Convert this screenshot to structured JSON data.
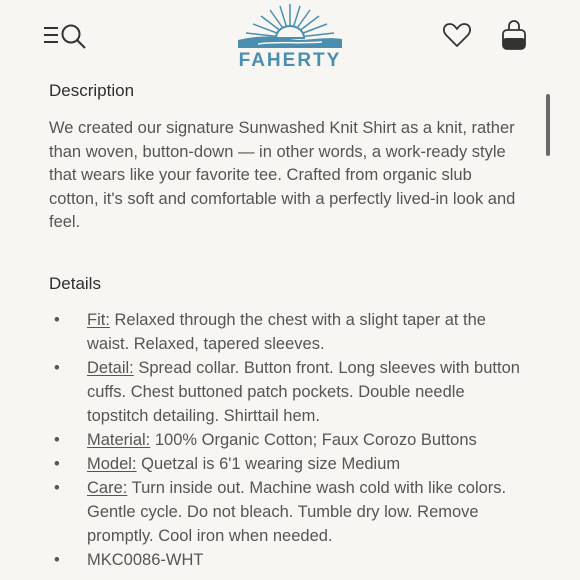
{
  "header": {
    "brand": "FAHERTY",
    "icons": [
      "menu-icon",
      "search-icon",
      "heart-icon",
      "bag-icon"
    ]
  },
  "description": {
    "title": "Description",
    "text": "We created our signature Sunwashed Knit Shirt as a knit, rather than woven, button-down — in other words, a work-ready style that wears like your favorite tee. Crafted from organic slub cotton, it's soft and comfortable with a perfectly lived-in look and feel."
  },
  "details": {
    "title": "Details",
    "items": [
      {
        "label": "Fit:",
        "text": " Relaxed through the chest with a slight taper at the waist. Relaxed, tapered sleeves."
      },
      {
        "label": "Detail:",
        "text": " Spread collar. Button front. Long sleeves with button cuffs. Chest buttoned patch pockets. Double needle topstitch detailing. Shirttail hem."
      },
      {
        "label": "Material:",
        "text": " 100% Organic Cotton; Faux Corozo Buttons"
      },
      {
        "label": "Model:",
        "text": " Quetzal is 6'1 wearing size Medium"
      },
      {
        "label": "Care:",
        "text": " Turn inside out. Machine wash cold with like colors. Gentle cycle. Do not bleach. Tumble dry low. Remove promptly. Cool iron when needed."
      },
      {
        "label": "",
        "text": "MKC0086-WHT"
      }
    ]
  },
  "colors": {
    "brand": "#4a8fb0",
    "text": "#555555",
    "background": "#f7f6f2"
  }
}
